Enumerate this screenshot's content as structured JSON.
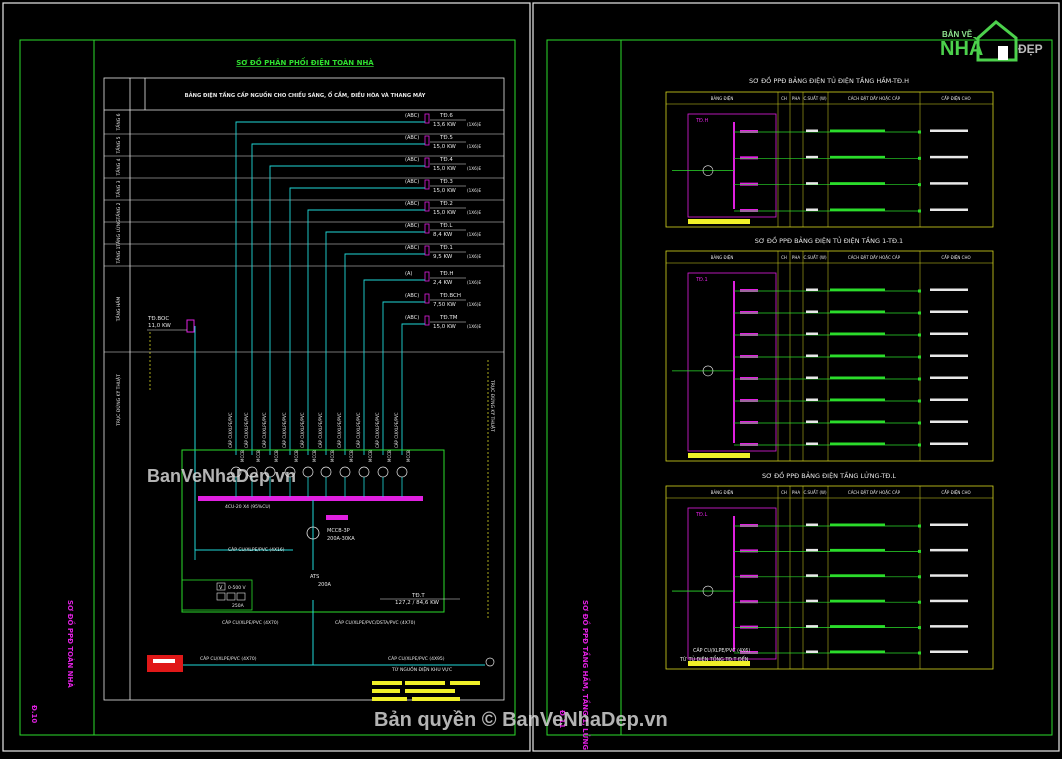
{
  "watermark": {
    "logo_top": "BẢN VẼ",
    "logo_mid": "NHÀ",
    "logo_right": "ĐẸP",
    "mid_text": "BanVeNhaDep.vn",
    "copyright": "Bản quyền © BanVeNhaDep.vn"
  },
  "left_sheet": {
    "title": "SƠ ĐỒ PHÂN PHỐI ĐIỆN TOÀN NHÀ",
    "table_header": "BẢNG ĐIỆN TẦNG CẤP NGUỒN CHO CHIẾU SÁNG, Ổ CẮM, ĐIỀU HÒA VÀ THANG MÁY",
    "side_title": "SƠ ĐỒ PPĐ TOÀN NHÀ",
    "sheet_no": "Đ.10",
    "floor_rows": [
      "TẦNG 6",
      "TẦNG 5",
      "TẦNG 4",
      "TẦNG 3",
      "TẦNG 2",
      "TẦNG LỬNG",
      "TẦNG 1",
      "TẦNG HẦM"
    ],
    "boards": [
      {
        "name": "TĐ.6",
        "kw": "13,6 KW",
        "tag": "(ABC)"
      },
      {
        "name": "TĐ.5",
        "kw": "15,0 KW",
        "tag": "(ABC)"
      },
      {
        "name": "TĐ.4",
        "kw": "15,0 KW",
        "tag": "(ABC)"
      },
      {
        "name": "TĐ.3",
        "kw": "15,0 KW",
        "tag": "(ABC)"
      },
      {
        "name": "TĐ.2",
        "kw": "15,0 KW",
        "tag": "(ABC)"
      },
      {
        "name": "TĐ.L",
        "kw": "8,4 KW",
        "tag": "(ABC)"
      },
      {
        "name": "TĐ.1",
        "kw": "9,5 KW",
        "tag": "(ABC)"
      },
      {
        "name": "TĐ.H",
        "kw": "2,4 KW",
        "tag": "(A)"
      },
      {
        "name": "TĐ.BCH",
        "kw": "7,50 KW",
        "tag": "(ABC)"
      },
      {
        "name": "TĐ.TM",
        "kw": "15,0 KW",
        "tag": "(ABC)"
      }
    ],
    "pump_board": {
      "name": "TĐ.BOC",
      "kw": "11,0 KW"
    },
    "main_board": {
      "name": "TĐ.T",
      "kw": "127,2 / 84,6 KW"
    },
    "busbar_label": "4CU-20 X4 (95%CU)",
    "mccb_main": "MCCB-3P",
    "mccb_main_rating": "200A-30KA",
    "ats_label": "ATS",
    "ats_rating": "200A",
    "meter_v": "0-500 V",
    "meter_a": "250A",
    "cable_main": "CÁP CU/XLPE/PVC (4X70)",
    "cable_from_grid": "CÁP CU/XLPE/PVC/DSTA/PVC (4X70)",
    "cable_gen": "CÁP CU/XLPE/PVC (4X70)",
    "cable_source": "CÁP CU/XLPE/PVC (4X95)",
    "source_label": "TỪ NGUỒN ĐIỆN KHU VỰC",
    "riser_label": "TRỤC ĐỨNG KỸ THUẬT"
  },
  "right_sheet": {
    "side_title": "SƠ ĐỒ PPĐ TẦNG HẦM, TẦNG 1, LỬNG",
    "sheet_no": "Đ.11",
    "col_headers": [
      "BẢNG ĐIỆN",
      "CH",
      "PHA",
      "C.SUẤT (W)",
      "CÁCH ĐẶT DÂY HOẶC CÁP",
      "CẤP ĐIỆN CHO"
    ],
    "diagrams": [
      {
        "title": "SƠ ĐỒ PPĐ BẢNG ĐIỆN TỦ ĐIỆN TẦNG HẦM-TĐ.H",
        "board": "TĐ.H",
        "circuits": 4
      },
      {
        "title": "SƠ ĐỒ PPĐ BẢNG ĐIỆN TỦ ĐIỆN TẦNG 1-TĐ.1",
        "board": "TĐ.1",
        "circuits": 8
      },
      {
        "title": "SƠ ĐỒ PPĐ BẢNG ĐIỆN TẦNG LỬNG-TĐ.L",
        "board": "TĐ.L",
        "circuits": 6
      }
    ],
    "note_cable": "CÁP CU/XLPE/PVC (4X6)",
    "note_from": "TỪ TỦ ĐIỆN TỔNG TĐ.T ĐẾN"
  },
  "colors": {
    "frame_green": "#2bdc2b",
    "frame_white": "#e8e8e8",
    "cyan": "#20d8d8",
    "yellow": "#f0f028",
    "magenta": "#e020e0",
    "red": "#e01818",
    "title_green": "#30e030",
    "table_yellow": "#d8d820"
  }
}
